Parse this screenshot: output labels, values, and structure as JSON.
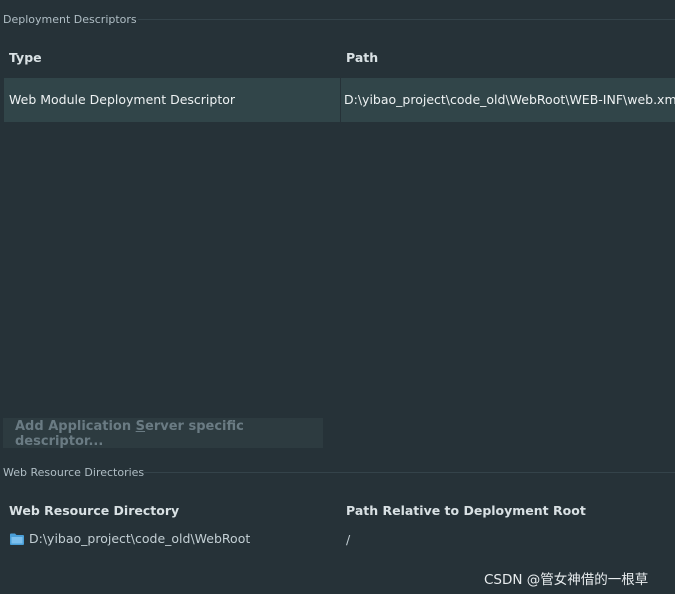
{
  "deployment_descriptors": {
    "section_title": "Deployment Descriptors",
    "columns": [
      "Type",
      "Path"
    ],
    "rows": [
      {
        "type": "Web Module Deployment Descriptor",
        "path": "D:\\yibao_project\\code_old\\WebRoot\\WEB-INF\\web.xml"
      }
    ],
    "add_button_prefix": "Add Application ",
    "add_button_mnemonic": "S",
    "add_button_suffix": "erver specific descriptor..."
  },
  "web_resource_directories": {
    "section_title": "Web Resource Directories",
    "columns": [
      "Web Resource Directory",
      "Path Relative to Deployment Root"
    ],
    "rows": [
      {
        "directory": "D:\\yibao_project\\code_old\\WebRoot",
        "relative_path": "/",
        "icon": "folder-icon"
      }
    ]
  },
  "watermark": "CSDN @管女神借的一根草",
  "colors": {
    "background": "#263238",
    "selected_row": "#314549",
    "folder_icon": "#4a9fd8"
  }
}
